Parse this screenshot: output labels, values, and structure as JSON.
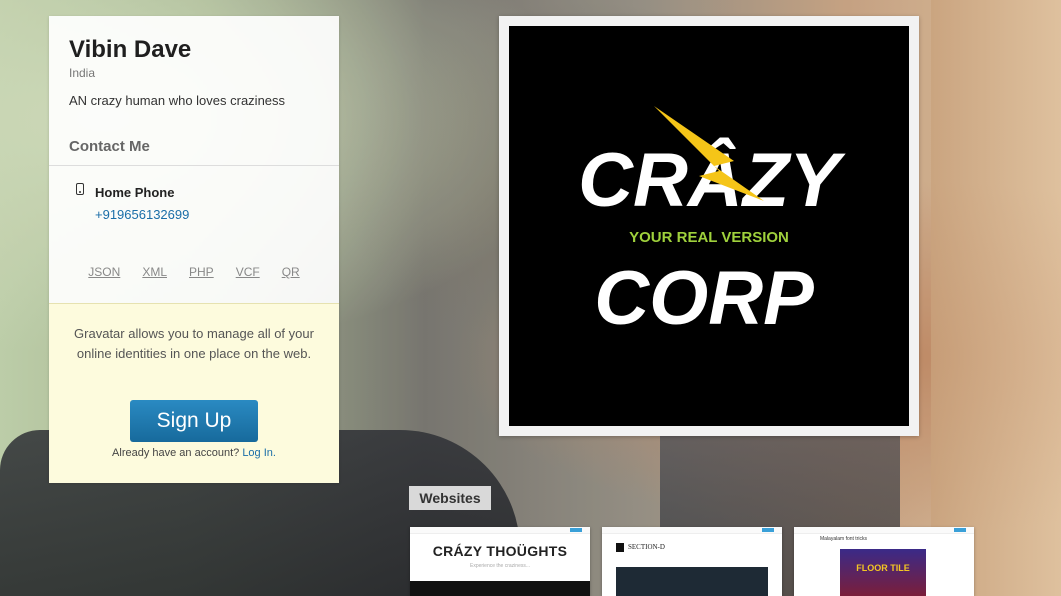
{
  "profile": {
    "name": "Vibin Dave",
    "location": "India",
    "about": "AN crazy human who loves craziness",
    "contact_heading": "Contact Me",
    "phone_label": "Home Phone",
    "phone_number": "+919656132699",
    "formats": [
      "JSON",
      "XML",
      "PHP",
      "VCF",
      "QR"
    ]
  },
  "promo": {
    "text": "Gravatar allows you to manage all of your online identities in one place on the web.",
    "signup_label": "Sign Up",
    "account_text": "Already have an account?",
    "login_link": "Log In."
  },
  "logo": {
    "word1": "CRÂZY",
    "tagline": "YOUR REAL VERSION",
    "word2": "CORP",
    "bolt_color": "#f5c518",
    "tagline_color": "#9fd13c"
  },
  "websites": {
    "label": "Websites",
    "items": [
      {
        "title": "CRÁZY THOÜGHTS",
        "subtitle": "Experience the craziness..."
      },
      {
        "title": "SECTION-D"
      },
      {
        "title": "Malayalam font tricks",
        "image_text": "FLOOR TILE"
      }
    ]
  },
  "colors": {
    "link": "#1a6ea8",
    "signup": "#1f7db5",
    "promo_bg": "#fdfbdd"
  }
}
